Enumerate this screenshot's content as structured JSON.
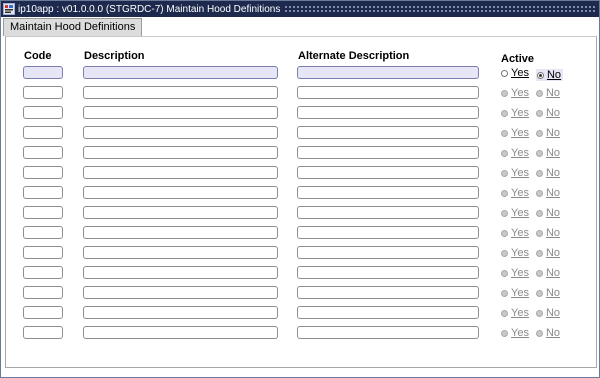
{
  "window": {
    "title": "ip10app : v01.0.0.0 (STGRDC-7) Maintain Hood Definitions",
    "app_icon": "app-icon"
  },
  "tabs": [
    {
      "label": "Maintain Hood Definitions"
    }
  ],
  "columns": {
    "code": "Code",
    "description": "Description",
    "alternate": "Alternate Description",
    "active": "Active"
  },
  "radio": {
    "yes": "Yes",
    "no": "No"
  },
  "rows": [
    {
      "code": "",
      "description": "",
      "alternate": "",
      "active": "No"
    },
    {
      "code": "",
      "description": "",
      "alternate": "",
      "active": ""
    },
    {
      "code": "",
      "description": "",
      "alternate": "",
      "active": ""
    },
    {
      "code": "",
      "description": "",
      "alternate": "",
      "active": ""
    },
    {
      "code": "",
      "description": "",
      "alternate": "",
      "active": ""
    },
    {
      "code": "",
      "description": "",
      "alternate": "",
      "active": ""
    },
    {
      "code": "",
      "description": "",
      "alternate": "",
      "active": ""
    },
    {
      "code": "",
      "description": "",
      "alternate": "",
      "active": ""
    },
    {
      "code": "",
      "description": "",
      "alternate": "",
      "active": ""
    },
    {
      "code": "",
      "description": "",
      "alternate": "",
      "active": ""
    },
    {
      "code": "",
      "description": "",
      "alternate": "",
      "active": ""
    },
    {
      "code": "",
      "description": "",
      "alternate": "",
      "active": ""
    },
    {
      "code": "",
      "description": "",
      "alternate": "",
      "active": ""
    },
    {
      "code": "",
      "description": "",
      "alternate": "",
      "active": ""
    }
  ]
}
